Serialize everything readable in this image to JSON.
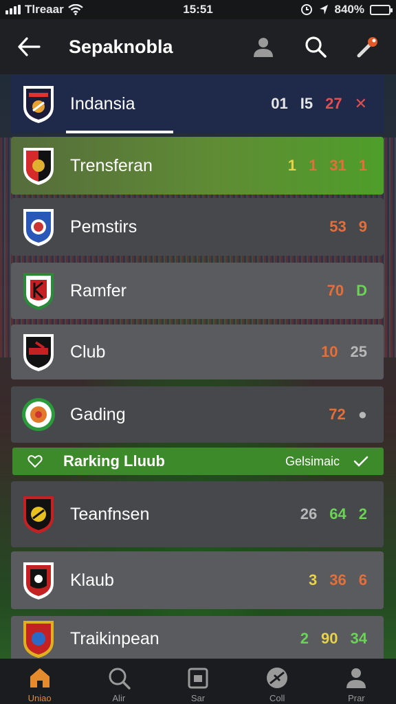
{
  "status_bar": {
    "carrier": "Tlreaar",
    "time": "15:51",
    "battery": "840%"
  },
  "header": {
    "title": "Sepaknobla"
  },
  "rows": [
    {
      "name": "Indansia",
      "stats": [
        "01",
        "I5",
        "27",
        "✕"
      ],
      "colors": [
        "c-white",
        "c-white",
        "c-red",
        "c-red"
      ]
    },
    {
      "name": "Trensferan",
      "stats": [
        "1",
        "1",
        "31",
        "1"
      ],
      "colors": [
        "c-yellow",
        "c-orange",
        "c-orange",
        "c-orange"
      ]
    },
    {
      "name": "Pemstirs",
      "stats": [
        "53",
        "9"
      ],
      "colors": [
        "c-orange",
        "c-orange"
      ]
    },
    {
      "name": "Ramfer",
      "stats": [
        "70",
        "D"
      ],
      "colors": [
        "c-orange",
        "c-green"
      ]
    },
    {
      "name": "Club",
      "stats": [
        "10",
        "25"
      ],
      "colors": [
        "c-orange",
        "c-grey"
      ]
    },
    {
      "name": "Gading",
      "stats": [
        "72",
        "●"
      ],
      "colors": [
        "c-orange",
        "c-grey"
      ]
    },
    {
      "name": "Teanfnsen",
      "stats": [
        "26",
        "64",
        "2"
      ],
      "colors": [
        "c-grey",
        "c-green",
        "c-green"
      ]
    },
    {
      "name": "Klaub",
      "stats": [
        "3",
        "36",
        "6"
      ],
      "colors": [
        "c-yellow",
        "c-orange",
        "c-orange"
      ]
    },
    {
      "name": "Traikinpean",
      "stats": [
        "2",
        "90",
        "34"
      ],
      "colors": [
        "c-green",
        "c-yellow",
        "c-green"
      ]
    }
  ],
  "ranking": {
    "title": "Rarking Lluub",
    "subtitle": "Gelsimaic"
  },
  "nav": [
    {
      "label": "Uniao",
      "icon": "home-icon"
    },
    {
      "label": "Alir",
      "icon": "search-icon"
    },
    {
      "label": "Sar",
      "icon": "calendar-icon"
    },
    {
      "label": "Coll",
      "icon": "ball-icon"
    },
    {
      "label": "Prar",
      "icon": "profile-icon"
    }
  ]
}
